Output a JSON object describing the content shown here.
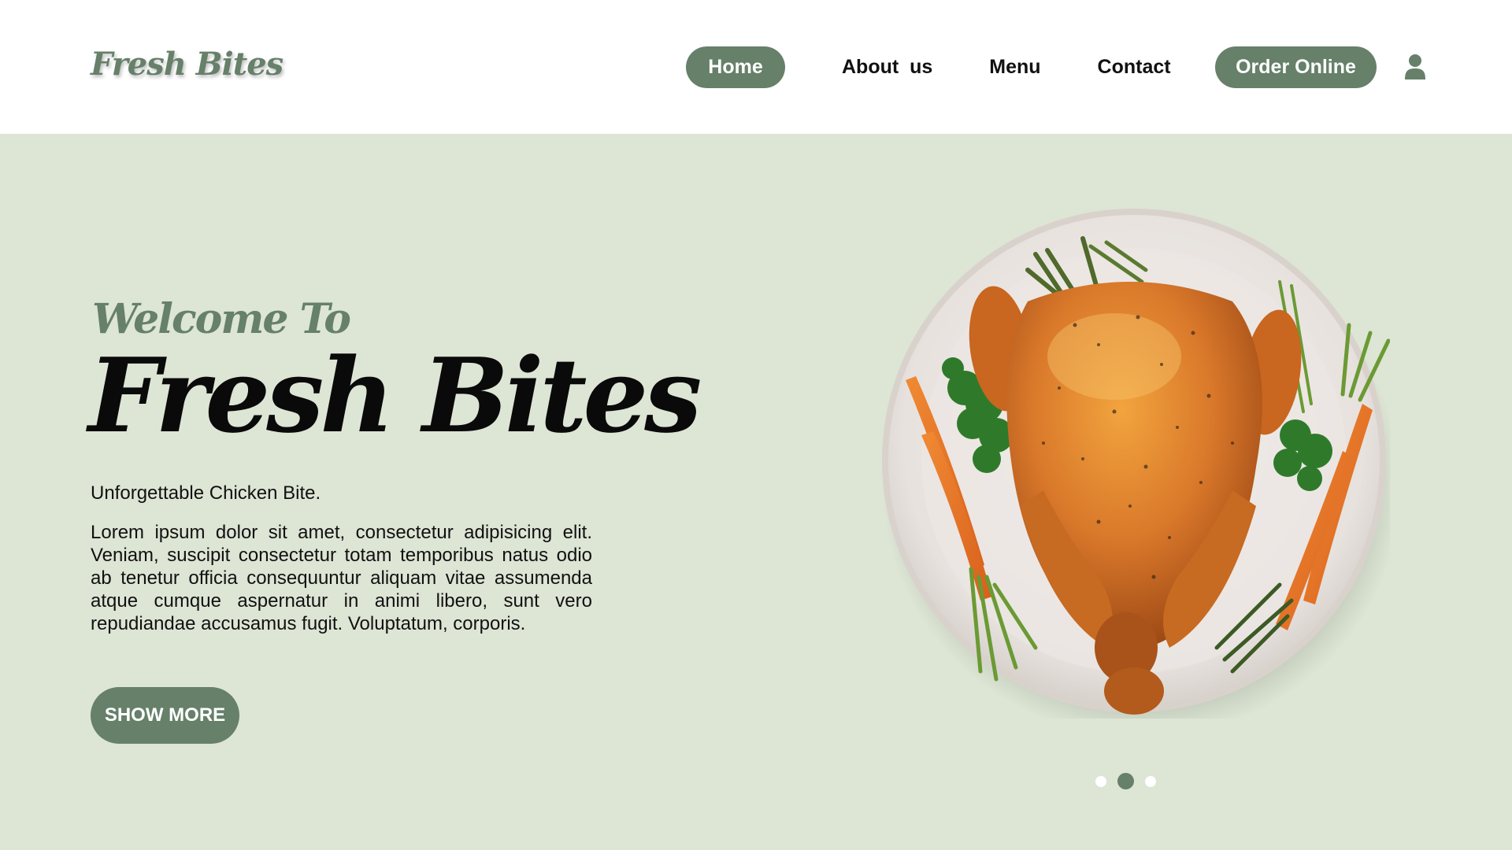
{
  "header": {
    "logo": "Fresh Bites",
    "nav": [
      {
        "label": "Home"
      },
      {
        "label": "About  us"
      },
      {
        "label": "Menu"
      },
      {
        "label": "Contact"
      }
    ],
    "order_button": "Order Online",
    "user_icon": "user-icon"
  },
  "hero": {
    "welcome": "Welcome To",
    "brand": "Fresh Bites",
    "tagline": "Unforgettable Chicken Bite.",
    "body": "Lorem ipsum dolor sit amet, consectetur adipisicing elit. Veniam, suscipit consectetur totam temporibus natus odio ab tenetur officia consequuntur aliquam vitae assumenda atque cumque aspernatur in animi libero, sunt vero repudiandae accusamus fugit. Voluptatum, corporis.",
    "cta": "SHOW MORE",
    "image": "roast-chicken-plate",
    "carousel": {
      "count": 3,
      "active": 2
    }
  },
  "colors": {
    "accent": "#66806a",
    "hero_bg": "#dde5d5",
    "header_bg": "#ffffff",
    "text": "#111111"
  }
}
